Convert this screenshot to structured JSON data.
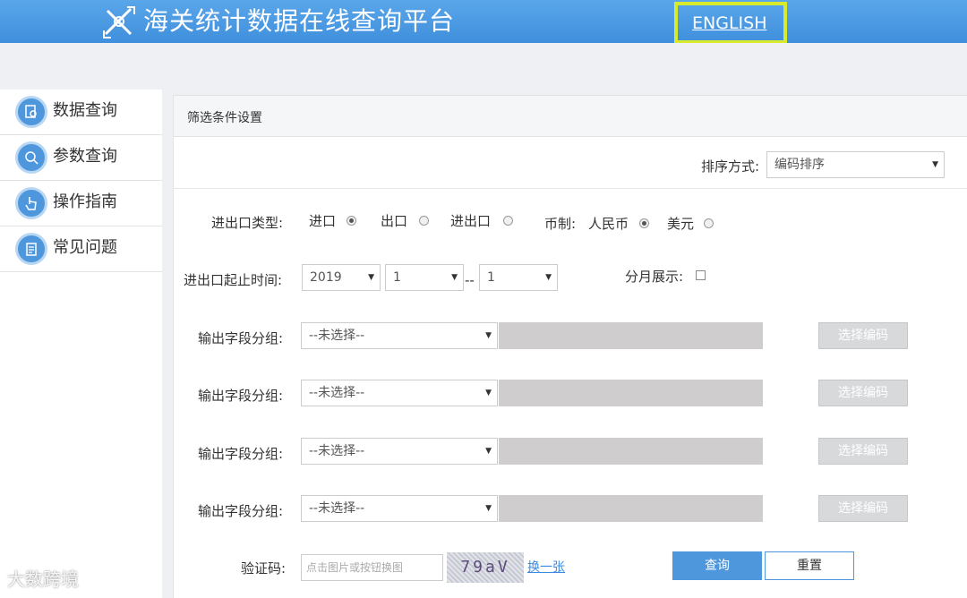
{
  "header": {
    "title": "海关统计数据在线查询平台",
    "english_link": "ENGLISH"
  },
  "sidebar": {
    "items": [
      {
        "label": "数据查询",
        "icon": "document-search-icon"
      },
      {
        "label": "参数查询",
        "icon": "magnifier-icon"
      },
      {
        "label": "操作指南",
        "icon": "hand-pointer-icon"
      },
      {
        "label": "常见问题",
        "icon": "clipboard-icon"
      }
    ]
  },
  "panel": {
    "title": "筛选条件设置"
  },
  "sort": {
    "label": "排序方式:",
    "value": "编码排序"
  },
  "trade_type": {
    "label": "进出口类型:",
    "options": [
      {
        "label": "进口",
        "selected": true
      },
      {
        "label": "出口",
        "selected": false
      },
      {
        "label": "进出口",
        "selected": false
      }
    ]
  },
  "currency": {
    "label": "币制:",
    "options": [
      {
        "label": "人民币",
        "selected": true
      },
      {
        "label": "美元",
        "selected": false
      }
    ]
  },
  "period": {
    "label": "进出口起止时间:",
    "year": "2019",
    "month_start": "1",
    "dash": "--",
    "month_end": "1"
  },
  "monthly": {
    "label": "分月展示:",
    "checked": false
  },
  "field_groups": [
    {
      "label": "输出字段分组:",
      "value": "--未选择--",
      "button": "选择编码"
    },
    {
      "label": "输出字段分组:",
      "value": "--未选择--",
      "button": "选择编码"
    },
    {
      "label": "输出字段分组:",
      "value": "--未选择--",
      "button": "选择编码"
    },
    {
      "label": "输出字段分组:",
      "value": "--未选择--",
      "button": "选择编码"
    }
  ],
  "captcha": {
    "label": "验证码:",
    "placeholder": "点击图片或按钮换图",
    "code": "79aV",
    "refresh": "换一张"
  },
  "actions": {
    "query": "查询",
    "reset": "重置"
  },
  "watermark": "大数跨境",
  "colors": {
    "header": "#4a9ae4",
    "accent": "#4f97dc",
    "highlight_box": "#d7ea2c"
  }
}
